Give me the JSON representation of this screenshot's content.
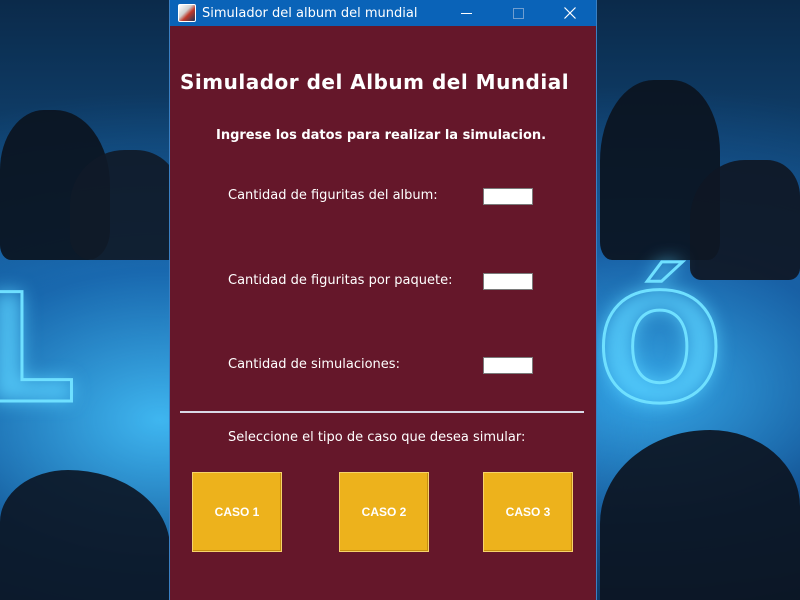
{
  "window": {
    "title": "Simulador del album del mundial",
    "controls": [
      "minimize-icon",
      "maximize-icon",
      "close-icon"
    ]
  },
  "form": {
    "heading": "Simulador del Album del Mundial",
    "subheading": "Ingrese los datos para realizar la simulacion.",
    "fields": [
      {
        "label": "Cantidad de figuritas del album:",
        "value": ""
      },
      {
        "label": "Cantidad de figuritas por paquete:",
        "value": ""
      },
      {
        "label": "Cantidad de simulaciones:",
        "value": ""
      }
    ],
    "case_prompt": "Seleccione el tipo de caso que desea simular:",
    "cases": [
      "CASO 1",
      "CASO 2",
      "CASO 3"
    ]
  },
  "colors": {
    "window_bg": "#65172a",
    "titlebar": "#0a63b8",
    "case_button": "#edb21c"
  },
  "background": {
    "text": "LEÓN"
  }
}
